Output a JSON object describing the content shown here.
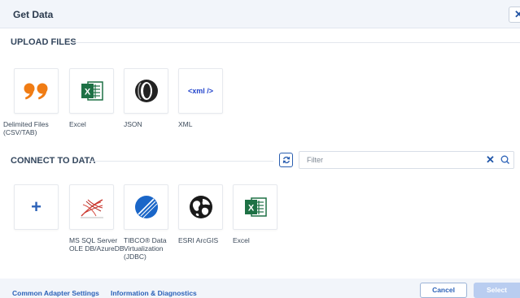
{
  "dialog": {
    "title": "Get Data",
    "close_symbol": "✕"
  },
  "upload": {
    "header": "UPLOAD FILES",
    "items": [
      {
        "label": "Delimited Files (CSV/TAB)",
        "icon": "quote-icon",
        "color": "#f07c14"
      },
      {
        "label": "Excel",
        "icon": "excel-icon",
        "color": "#1e7145"
      },
      {
        "label": "JSON",
        "icon": "json-icon",
        "color": "#222222"
      },
      {
        "label": "XML",
        "icon": "xml-icon",
        "color": "#2244cc",
        "icon_text": "<xml />"
      }
    ]
  },
  "connect": {
    "header": "CONNECT TO DATA",
    "filter_placeholder": "Filter",
    "filter_value": "",
    "items": [
      {
        "label": "",
        "icon": "plus-icon",
        "color": "#2c62b8"
      },
      {
        "label": "MS SQL Server OLE DB/AzureDB",
        "icon": "sql-server-icon",
        "color": "#c8312a"
      },
      {
        "label": "TIBCO® Data Virtualization (JDBC)",
        "icon": "tibco-icon",
        "color": "#1a66c8"
      },
      {
        "label": "ESRI ArcGIS",
        "icon": "globe-icon",
        "color": "#1a1a1a"
      },
      {
        "label": "Excel",
        "icon": "excel-icon",
        "color": "#1e7145"
      }
    ]
  },
  "footer": {
    "common_adapter_settings": "Common Adapter Settings",
    "information_diagnostics": "Information & Diagnostics",
    "cancel": "Cancel",
    "select": "Select"
  },
  "colors": {
    "accent": "#2c62b8",
    "header_bg": "#f2f5fa",
    "select_disabled": "#b9cdf0"
  }
}
